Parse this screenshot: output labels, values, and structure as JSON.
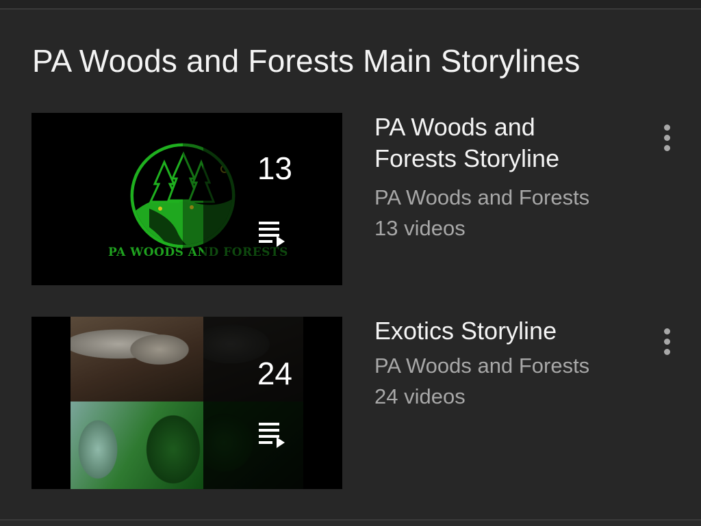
{
  "section": {
    "title": "PA Woods and Forests Main Storylines"
  },
  "playlists": [
    {
      "title": "PA Woods and Forests Storyline",
      "channel": "PA Woods and Forests",
      "video_count_label": "13 videos",
      "thumbnail_count": "13",
      "thumbnail_logo_text": "PA WOODS AND FORESTS",
      "menu_icon": "more-vert-icon",
      "playlist_icon": "playlist-play-icon"
    },
    {
      "title": "Exotics Storyline",
      "channel": "PA Woods and Forests",
      "video_count_label": "24 videos",
      "thumbnail_count": "24",
      "menu_icon": "more-vert-icon",
      "playlist_icon": "playlist-play-icon"
    }
  ],
  "colors": {
    "background": "#272727",
    "text_primary": "#f4f4f4",
    "text_secondary": "#a8a8a8",
    "logo_green": "#1fa11f"
  }
}
